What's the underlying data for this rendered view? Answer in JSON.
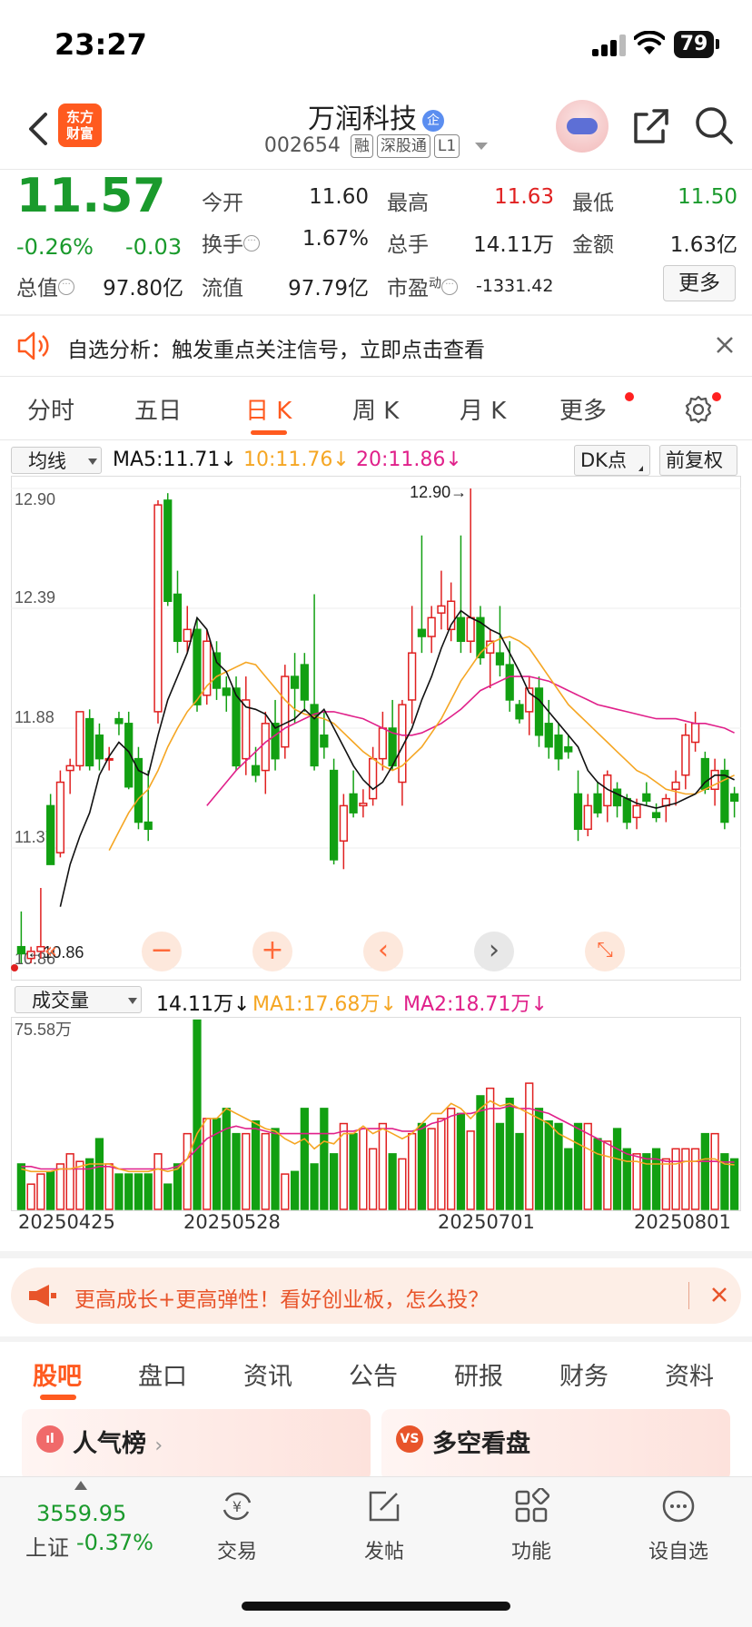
{
  "status": {
    "time": "23:27",
    "battery": "79"
  },
  "header": {
    "logo_line1": "东方",
    "logo_line2": "财富",
    "name": "万润科技",
    "badge": "企",
    "code": "002654",
    "tags": [
      "融",
      "深股通",
      "L1"
    ]
  },
  "quote": {
    "price": "11.57",
    "change_pct": "-0.26%",
    "change": "-0.03",
    "fields": [
      {
        "label": "今开",
        "value": "11.60",
        "color": "#222222"
      },
      {
        "label": "最高",
        "value": "11.63",
        "color": "#e02020"
      },
      {
        "label": "最低",
        "value": "11.50",
        "color": "#1a9a2c"
      },
      {
        "label": "换手",
        "value": "1.67%",
        "color": "#222222"
      },
      {
        "label": "总手",
        "value": "14.11万",
        "color": "#222222"
      },
      {
        "label": "金额",
        "value": "1.63亿",
        "color": "#222222"
      },
      {
        "label": "总值",
        "value": "97.80亿",
        "color": "#222222"
      },
      {
        "label": "流值",
        "value": "97.79亿",
        "color": "#222222"
      },
      {
        "label": "市盈",
        "sup": "动",
        "value": "-1331.42",
        "color": "#222222"
      }
    ],
    "more_label": "更多"
  },
  "notice": {
    "text": "自选分析：触发重点关注信号，立即点击查看"
  },
  "period_tabs": [
    "分时",
    "五日",
    "日 K",
    "周 K",
    "月 K",
    "更多"
  ],
  "active_period": "日 K",
  "ma_bar": {
    "selector": "均线",
    "ma5": "MA5:11.71",
    "ma10": "10:11.76",
    "ma20": "20:11.86",
    "arrow": "↓",
    "dk": "DK点",
    "adjust": "前复权"
  },
  "vol_bar": {
    "selector": "成交量",
    "vol": "14.11万",
    "ma1": "MA1:17.68万",
    "ma2": "MA2:18.71万",
    "arrow": "↓"
  },
  "colors": {
    "up": "#e02020",
    "down": "#12a012",
    "ma5": "#111111",
    "ma10": "#f5a623",
    "ma20": "#e0208a",
    "accent": "#ff5a1f"
  },
  "chart_data": [
    {
      "type": "candlestick",
      "y_ticks": [
        "12.90",
        "12.39",
        "11.88",
        "11.37",
        "10.86"
      ],
      "ylim": [
        10.86,
        12.9
      ],
      "annotations": {
        "high": "12.90→",
        "low": "←10.86"
      },
      "x_labels": [
        "20250425",
        "20250528",
        "20250701",
        "20250801"
      ],
      "ohlc": [
        [
          10.95,
          11.1,
          10.88,
          10.92
        ],
        [
          10.9,
          10.95,
          10.88,
          10.93
        ],
        [
          10.93,
          11.2,
          10.9,
          10.95
        ],
        [
          11.55,
          11.6,
          11.3,
          11.3
        ],
        [
          11.35,
          11.7,
          11.33,
          11.65
        ],
        [
          11.7,
          11.75,
          11.6,
          11.72
        ],
        [
          11.72,
          11.95,
          11.7,
          11.95
        ],
        [
          11.92,
          11.96,
          11.7,
          11.72
        ],
        [
          11.85,
          11.9,
          11.7,
          11.75
        ],
        [
          11.75,
          11.8,
          11.7,
          11.75
        ],
        [
          11.92,
          11.95,
          11.85,
          11.9
        ],
        [
          11.9,
          11.95,
          11.62,
          11.63
        ],
        [
          11.75,
          11.8,
          11.45,
          11.48
        ],
        [
          11.48,
          11.7,
          11.4,
          11.45
        ],
        [
          11.95,
          12.85,
          11.9,
          12.83
        ],
        [
          12.85,
          12.88,
          12.4,
          12.42
        ],
        [
          12.45,
          12.55,
          12.2,
          12.25
        ],
        [
          12.25,
          12.4,
          12.2,
          12.3
        ],
        [
          12.3,
          12.35,
          11.95,
          11.98
        ],
        [
          12.02,
          12.3,
          11.98,
          12.25
        ],
        [
          12.2,
          12.25,
          12.0,
          12.05
        ],
        [
          12.05,
          12.1,
          11.95,
          12.02
        ],
        [
          12.05,
          12.1,
          11.7,
          11.72
        ],
        [
          11.75,
          12.1,
          11.68,
          12.0
        ],
        [
          11.72,
          11.8,
          11.65,
          11.68
        ],
        [
          11.7,
          11.95,
          11.6,
          11.9
        ],
        [
          11.9,
          12.0,
          11.7,
          11.75
        ],
        [
          11.8,
          12.15,
          11.75,
          12.1
        ],
        [
          12.1,
          12.2,
          11.9,
          12.05
        ],
        [
          12.15,
          12.2,
          11.95,
          12.0
        ],
        [
          11.98,
          12.45,
          11.7,
          11.72
        ],
        [
          11.85,
          11.95,
          11.75,
          11.8
        ],
        [
          11.7,
          11.75,
          11.3,
          11.32
        ],
        [
          11.4,
          11.6,
          11.28,
          11.55
        ],
        [
          11.6,
          11.7,
          11.5,
          11.52
        ],
        [
          11.55,
          11.62,
          11.5,
          11.56
        ],
        [
          11.58,
          11.8,
          11.55,
          11.75
        ],
        [
          11.75,
          11.95,
          11.7,
          11.88
        ],
        [
          11.88,
          12.0,
          11.7,
          11.72
        ],
        [
          11.65,
          12.0,
          11.55,
          11.98
        ],
        [
          12.0,
          12.4,
          11.9,
          12.2
        ],
        [
          12.3,
          12.7,
          12.2,
          12.27
        ],
        [
          12.27,
          12.4,
          12.2,
          12.35
        ],
        [
          12.37,
          12.55,
          12.3,
          12.4
        ],
        [
          12.3,
          12.5,
          12.25,
          12.42
        ],
        [
          12.35,
          12.7,
          12.2,
          12.25
        ],
        [
          12.25,
          12.9,
          12.2,
          12.35
        ],
        [
          12.35,
          12.4,
          12.15,
          12.18
        ],
        [
          12.2,
          12.3,
          12.05,
          12.25
        ],
        [
          12.2,
          12.4,
          12.1,
          12.15
        ],
        [
          12.15,
          12.25,
          11.95,
          12.0
        ],
        [
          11.98,
          12.0,
          11.9,
          11.92
        ],
        [
          11.95,
          12.1,
          11.85,
          12.05
        ],
        [
          12.05,
          12.1,
          11.8,
          11.85
        ],
        [
          11.9,
          12.0,
          11.75,
          11.8
        ],
        [
          11.85,
          11.9,
          11.7,
          11.75
        ],
        [
          11.8,
          11.85,
          11.75,
          11.78
        ],
        [
          11.6,
          11.7,
          11.4,
          11.45
        ],
        [
          11.45,
          11.6,
          11.42,
          11.55
        ],
        [
          11.6,
          11.65,
          11.5,
          11.52
        ],
        [
          11.55,
          11.7,
          11.48,
          11.68
        ],
        [
          11.62,
          11.65,
          11.5,
          11.55
        ],
        [
          11.58,
          11.6,
          11.45,
          11.48
        ],
        [
          11.5,
          11.58,
          11.45,
          11.55
        ],
        [
          11.6,
          11.65,
          11.55,
          11.57
        ],
        [
          11.52,
          11.56,
          11.48,
          11.5
        ],
        [
          11.55,
          11.6,
          11.48,
          11.58
        ],
        [
          11.62,
          11.7,
          11.55,
          11.65
        ],
        [
          11.68,
          11.9,
          11.62,
          11.85
        ],
        [
          11.82,
          11.95,
          11.78,
          11.9
        ],
        [
          11.75,
          11.78,
          11.6,
          11.62
        ],
        [
          11.62,
          11.75,
          11.55,
          11.7
        ],
        [
          11.7,
          11.75,
          11.45,
          11.48
        ],
        [
          11.6,
          11.63,
          11.5,
          11.57
        ]
      ],
      "ma5": [
        null,
        null,
        null,
        null,
        11.12,
        11.3,
        11.42,
        11.52,
        11.68,
        11.76,
        11.82,
        11.78,
        11.7,
        11.68,
        11.85,
        12.0,
        12.1,
        12.2,
        12.35,
        12.3,
        12.16,
        12.12,
        12.02,
        11.97,
        11.96,
        11.94,
        11.88,
        11.9,
        11.92,
        11.96,
        11.92,
        11.96,
        11.88,
        11.8,
        11.72,
        11.66,
        11.62,
        11.65,
        11.72,
        11.8,
        11.88,
        12.0,
        12.1,
        12.22,
        12.32,
        12.38,
        12.35,
        12.33,
        12.3,
        12.28,
        12.2,
        12.12,
        12.03,
        12.0,
        11.95,
        11.9,
        11.85,
        11.8,
        11.7,
        11.65,
        11.62,
        11.6,
        11.58,
        11.56,
        11.55,
        11.54,
        11.55,
        11.56,
        11.58,
        11.6,
        11.65,
        11.68,
        11.68,
        11.66
      ],
      "ma10": [
        null,
        null,
        null,
        null,
        null,
        null,
        null,
        null,
        null,
        11.36,
        11.44,
        11.52,
        11.58,
        11.62,
        11.7,
        11.8,
        11.88,
        11.95,
        12.0,
        12.06,
        12.1,
        12.12,
        12.14,
        12.16,
        12.15,
        12.1,
        12.05,
        12.0,
        11.96,
        11.94,
        11.93,
        11.92,
        11.9,
        11.86,
        11.82,
        11.78,
        11.75,
        11.72,
        11.7,
        11.72,
        11.76,
        11.8,
        11.86,
        11.92,
        12.0,
        12.08,
        12.14,
        12.2,
        12.24,
        12.26,
        12.27,
        12.25,
        12.22,
        12.16,
        12.1,
        12.04,
        11.98,
        11.94,
        11.9,
        11.86,
        11.82,
        11.78,
        11.74,
        11.7,
        11.68,
        11.65,
        11.62,
        11.61,
        11.6,
        11.6,
        11.62,
        11.64,
        11.66,
        11.68
      ],
      "ma20": [
        null,
        null,
        null,
        null,
        null,
        null,
        null,
        null,
        null,
        null,
        null,
        null,
        null,
        null,
        null,
        null,
        null,
        null,
        null,
        11.55,
        11.6,
        11.65,
        11.7,
        11.74,
        11.78,
        11.82,
        11.85,
        11.88,
        11.9,
        11.92,
        11.94,
        11.95,
        11.95,
        11.94,
        11.93,
        11.92,
        11.9,
        11.88,
        11.86,
        11.85,
        11.85,
        11.86,
        11.88,
        11.9,
        11.93,
        11.96,
        12.0,
        12.04,
        12.06,
        12.08,
        12.1,
        12.1,
        12.1,
        12.09,
        12.08,
        12.06,
        12.04,
        12.02,
        12.0,
        11.98,
        11.97,
        11.96,
        11.95,
        11.94,
        11.93,
        11.92,
        11.92,
        11.92,
        11.91,
        11.9,
        11.9,
        11.89,
        11.88,
        11.86
      ]
    },
    {
      "type": "bar",
      "name": "成交量",
      "y_max_label": "75.58万",
      "ylim": [
        0,
        75.58
      ],
      "unit": "万",
      "values": [
        18,
        10,
        14,
        15,
        18,
        22,
        19,
        20,
        28,
        18,
        14,
        14,
        14,
        14,
        22,
        10,
        18,
        30,
        75,
        36,
        36,
        40,
        30,
        30,
        35,
        30,
        32,
        14,
        15,
        40,
        18,
        40,
        22,
        34,
        30,
        32,
        24,
        34,
        22,
        20,
        30,
        34,
        32,
        36,
        40,
        38,
        31,
        45,
        48,
        34,
        44,
        30,
        50,
        40,
        35,
        34,
        24,
        34,
        34,
        28,
        27,
        32,
        24,
        22,
        22,
        24,
        20,
        24,
        24,
        24,
        30,
        30,
        22,
        20
      ],
      "ma1": [
        16,
        15,
        15,
        15,
        16,
        16,
        17,
        18,
        18,
        18,
        16,
        15,
        15,
        15,
        16,
        15,
        16,
        20,
        30,
        36,
        36,
        40,
        38,
        36,
        34,
        32,
        31,
        28,
        26,
        28,
        24,
        27,
        26,
        30,
        30,
        33,
        30,
        32,
        30,
        28,
        30,
        34,
        38,
        38,
        42,
        40,
        36,
        40,
        43,
        41,
        42,
        40,
        38,
        36,
        34,
        30,
        28,
        26,
        24,
        22,
        21,
        20,
        19,
        19,
        18,
        18,
        18,
        18,
        19,
        19,
        20,
        20,
        18,
        17.68
      ],
      "ma2": [
        17,
        17,
        16,
        16,
        16,
        16,
        16,
        16,
        17,
        17,
        16,
        16,
        16,
        16,
        16,
        16,
        17,
        20,
        24,
        28,
        30,
        32,
        33,
        32,
        32,
        31,
        30,
        30,
        30,
        30,
        30,
        30,
        30,
        31,
        31,
        32,
        32,
        32,
        32,
        31,
        31,
        32,
        34,
        35,
        37,
        38,
        38,
        39,
        40,
        40,
        41,
        40,
        40,
        39,
        38,
        36,
        34,
        32,
        30,
        28,
        26,
        24,
        22,
        21,
        20,
        20,
        19,
        19,
        19,
        19,
        19,
        19,
        18.8,
        18.71
      ]
    }
  ],
  "promo": {
    "text": "更高成长+更高弹性！看好创业板，怎么投？"
  },
  "bottom_tabs": [
    "股吧",
    "盘口",
    "资讯",
    "公告",
    "研报",
    "财务",
    "资料"
  ],
  "cards": [
    {
      "title": "人气榜",
      "icon": "ıl"
    },
    {
      "title": "多空看盘",
      "icon": "VS"
    }
  ],
  "tabbar": {
    "index_value": "3559.95",
    "index_name": "上证",
    "index_change": "-0.37%",
    "items": [
      "交易",
      "发帖",
      "功能",
      "设自选"
    ]
  }
}
